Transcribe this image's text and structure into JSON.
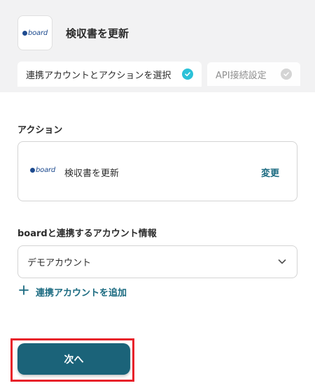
{
  "header": {
    "title": "検収書を更新",
    "logo_icon": "board-logo-icon",
    "logo_text": "board"
  },
  "tabs": [
    {
      "label": "連携アカウントとアクションを選択",
      "state": "active",
      "status_icon": "check-circle-icon"
    },
    {
      "label": "API接続設定",
      "state": "inactive",
      "status_icon": "check-circle-icon"
    }
  ],
  "action_section": {
    "label": "アクション",
    "card": {
      "app_logo_text": "board",
      "name": "検収書を更新",
      "change_label": "変更"
    }
  },
  "account_section": {
    "label": "boardと連携するアカウント情報",
    "selected_account": "デモアカウント",
    "add_account_label": "連携アカウントを追加"
  },
  "footer": {
    "next_label": "次へ"
  },
  "colors": {
    "header_bg": "#f2f2f3",
    "accent_teal": "#1b6379",
    "link": "#1a6a80",
    "active_check": "#2bc1d8",
    "highlight_red": "#e8202a"
  }
}
